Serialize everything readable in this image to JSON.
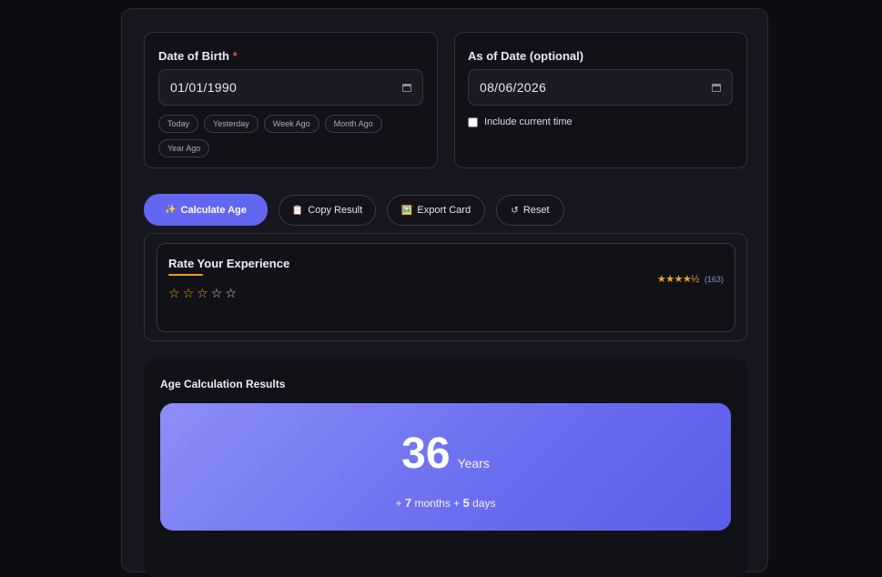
{
  "dob": {
    "label": "Date of Birth",
    "required_mark": "*",
    "value": "01/01/1990",
    "quick_picks": [
      "Today",
      "Yesterday",
      "Week Ago",
      "Month Ago",
      "Year Ago"
    ]
  },
  "as_of": {
    "label": "As of Date (optional)",
    "value": "08/06/2026",
    "include_time_label": "Include current time",
    "include_time_checked": false
  },
  "actions": {
    "calculate_icon": "✨",
    "calculate_label": "Calculate Age",
    "copy_icon": "📋",
    "copy_label": "Copy Result",
    "export_icon": "🖼️",
    "export_label": "Export Card",
    "reset_icon": "↺",
    "reset_label": "Reset"
  },
  "rating": {
    "title": "Rate Your Experience",
    "user_rating": 3,
    "max_rating": 5,
    "average_stars": "★★★★½",
    "count": "(163)"
  },
  "results": {
    "title": "Age Calculation Results",
    "years": "36",
    "years_label": "Years",
    "prefix": "+",
    "months": "7",
    "months_label": "months",
    "joiner": "+",
    "days": "5",
    "days_label": "days"
  },
  "colors": {
    "accent": "#6366f1",
    "star": "#f6a623",
    "required": "#ef4444"
  }
}
